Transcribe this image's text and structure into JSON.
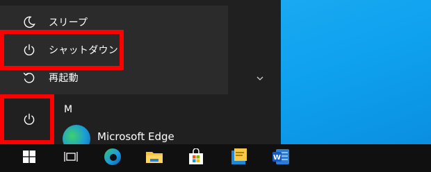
{
  "power_menu": {
    "items": [
      {
        "label": "スリープ",
        "icon": "moon-icon"
      },
      {
        "label": "シャットダウン",
        "icon": "power-icon"
      },
      {
        "label": "再起動",
        "icon": "restart-icon"
      }
    ]
  },
  "start_menu": {
    "section_letter": "M",
    "apps": [
      {
        "name": "Microsoft Edge",
        "icon": "edge-icon"
      }
    ],
    "power_button_icon": "power-icon",
    "expand_icon": "chevron-down-icon"
  },
  "taskbar": {
    "items": [
      {
        "name": "start-button",
        "icon": "windows-logo-icon"
      },
      {
        "name": "task-view-button",
        "icon": "task-view-icon"
      },
      {
        "name": "edge-taskbar-button",
        "icon": "edge-icon"
      },
      {
        "name": "file-explorer-button",
        "icon": "folder-icon"
      },
      {
        "name": "microsoft-store-button",
        "icon": "store-bag-icon"
      },
      {
        "name": "sticky-notes-button",
        "icon": "notes-icon"
      },
      {
        "name": "word-button",
        "icon": "word-icon"
      }
    ]
  },
  "colors": {
    "highlight": "#ff0000",
    "desktop": "#0ea1ee",
    "menu_bg": "#202020",
    "flyout_bg": "#2b2b2b",
    "taskbar_bg": "#101010"
  }
}
